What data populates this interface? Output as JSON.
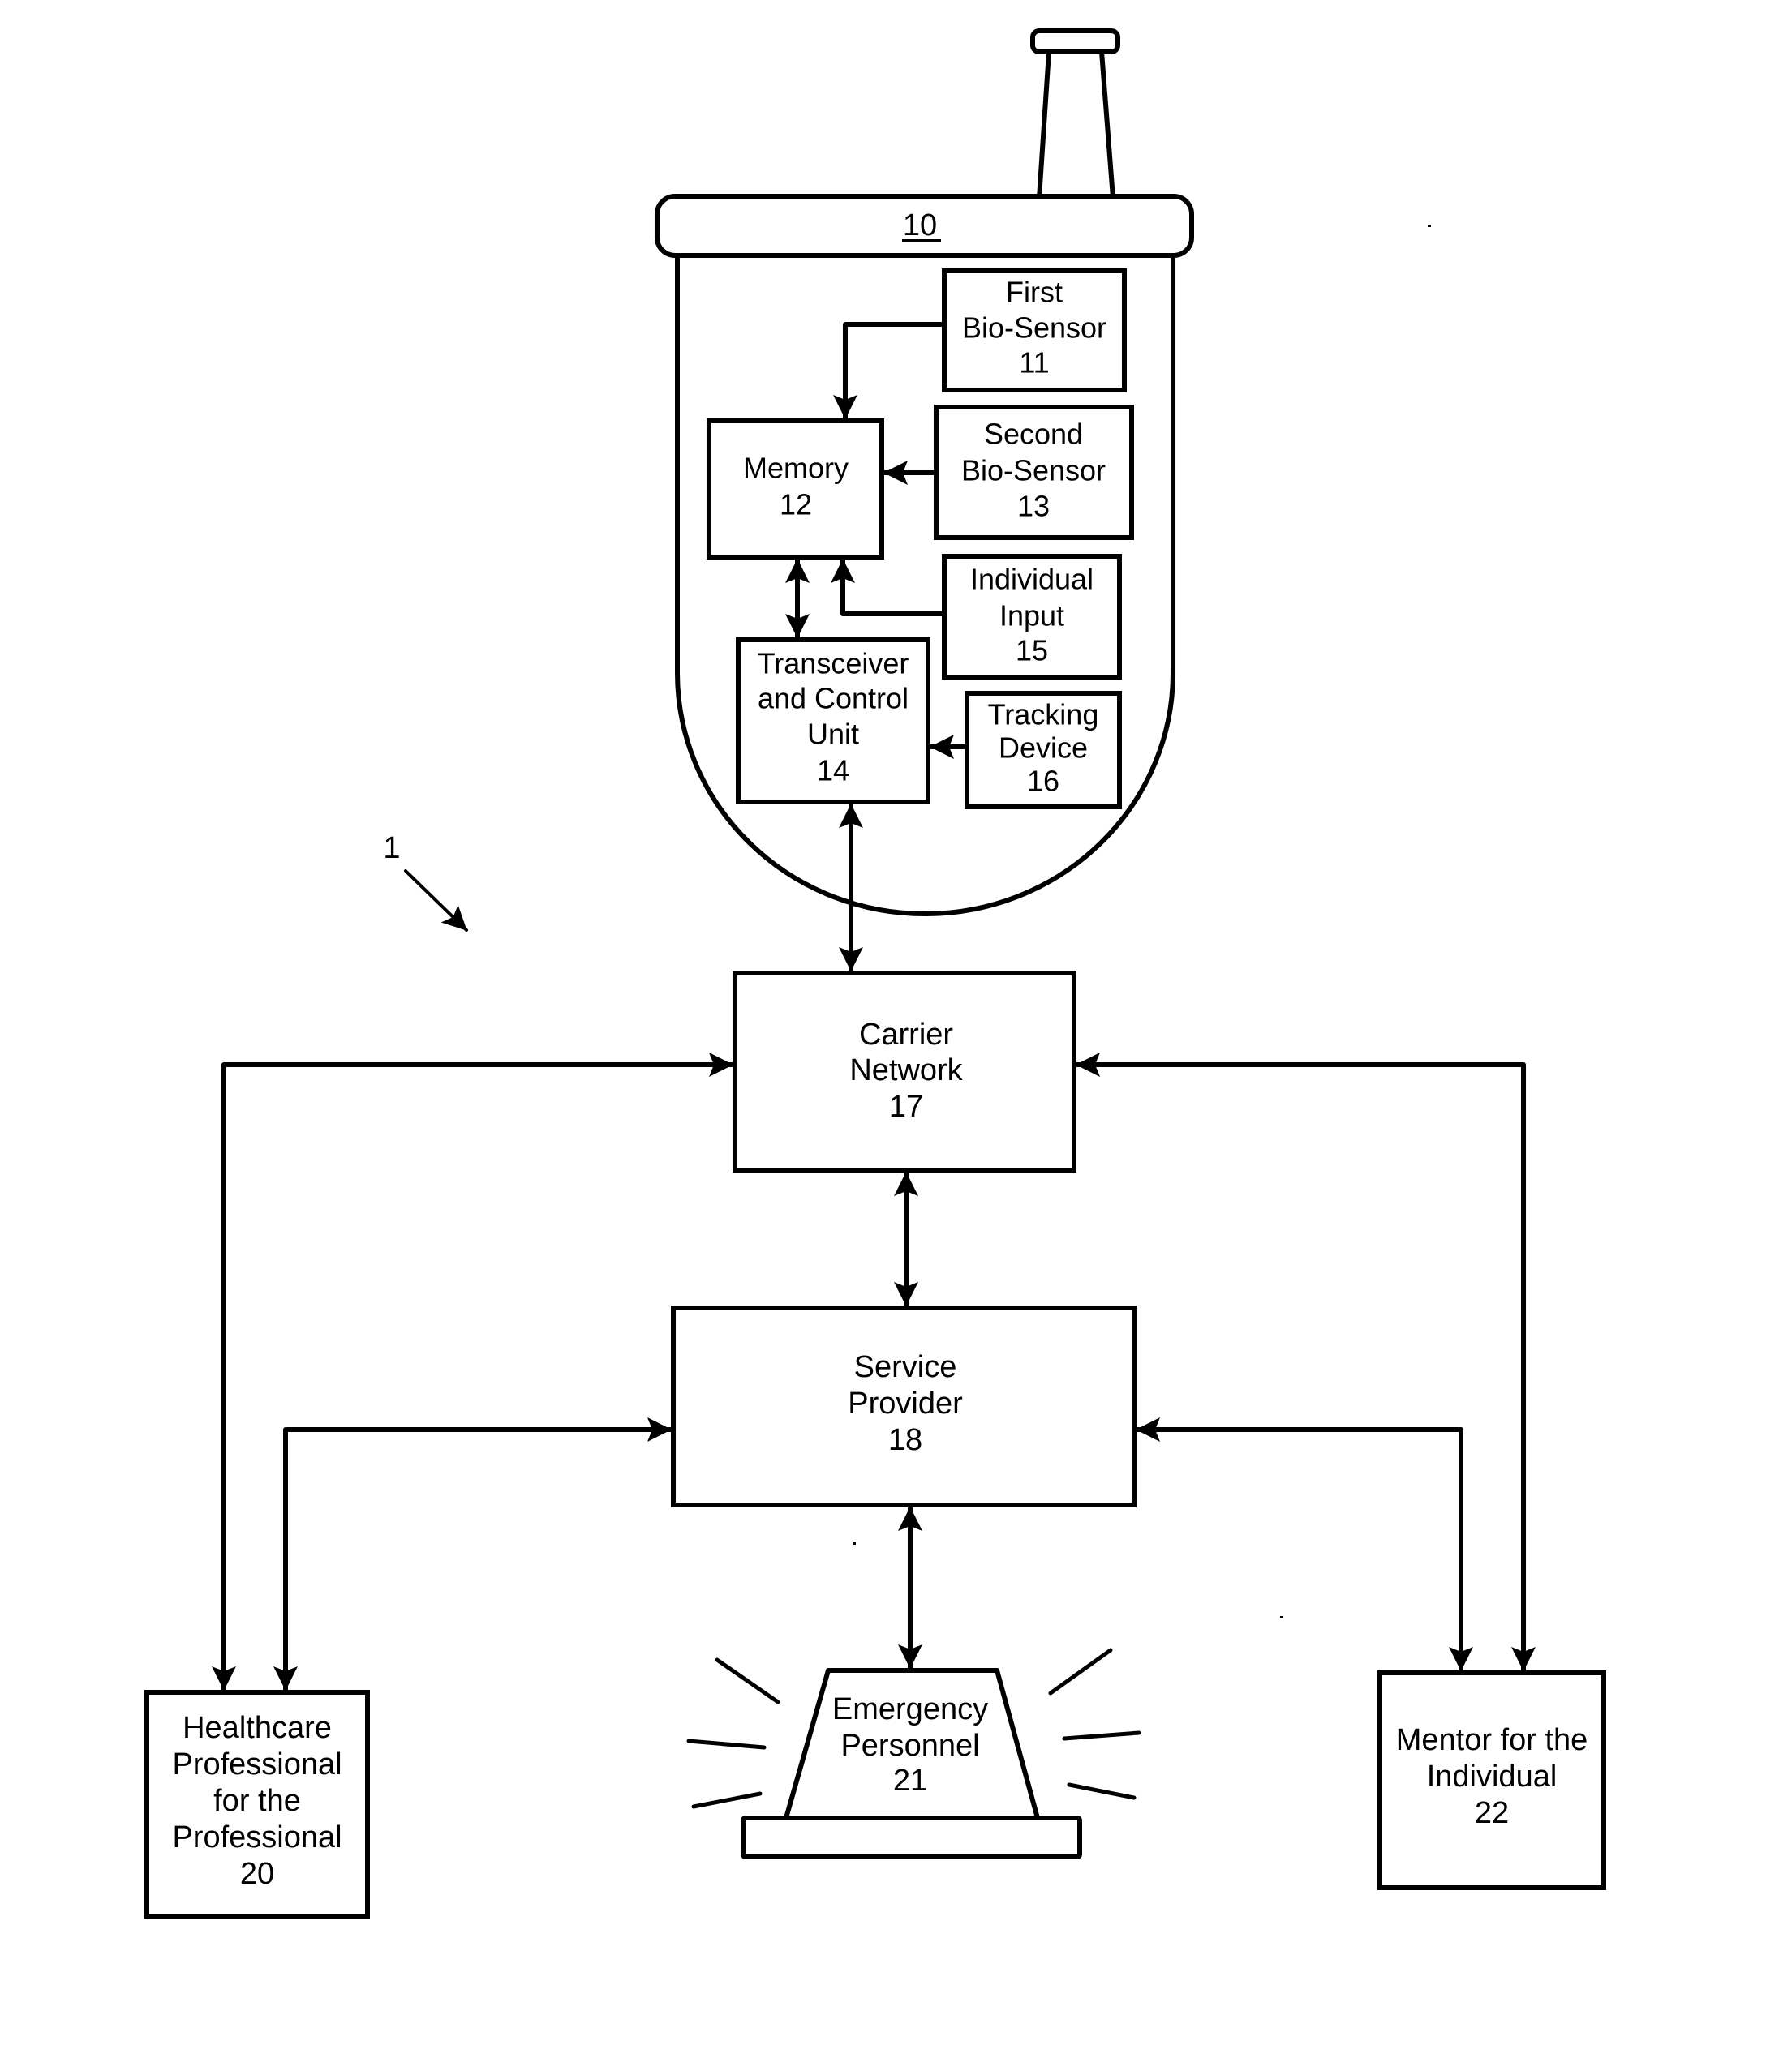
{
  "figure": {
    "system_ref": "1",
    "device": {
      "ref": "10",
      "components": {
        "first_bio_sensor": {
          "lines": [
            "First",
            "Bio-Sensor",
            "11"
          ]
        },
        "memory": {
          "lines": [
            "Memory",
            "12"
          ]
        },
        "second_bio_sensor": {
          "lines": [
            "Second",
            "Bio-Sensor",
            "13"
          ]
        },
        "transceiver": {
          "lines": [
            "Transceiver",
            "and Control",
            "Unit",
            "14"
          ]
        },
        "individual_input": {
          "lines": [
            "Individual",
            "Input",
            "15"
          ]
        },
        "tracking_device": {
          "lines": [
            "Tracking",
            "Device",
            "16"
          ]
        }
      }
    },
    "carrier_network": {
      "lines": [
        "Carrier",
        "Network",
        "17"
      ]
    },
    "service_provider": {
      "lines": [
        "Service",
        "Provider",
        "18"
      ]
    },
    "healthcare_professional": {
      "lines": [
        "Healthcare",
        "Professional",
        "for the",
        "Professional",
        "20"
      ]
    },
    "emergency_personnel": {
      "lines": [
        "Emergency",
        "Personnel",
        "21"
      ]
    },
    "mentor": {
      "lines": [
        "Mentor for the",
        "Individual",
        "22"
      ]
    },
    "connections": [
      {
        "from": "First Bio-Sensor 11",
        "to": "Memory 12",
        "direction": "one-way"
      },
      {
        "from": "Second Bio-Sensor 13",
        "to": "Memory 12",
        "direction": "one-way"
      },
      {
        "from": "Individual Input 15",
        "to": "Memory 12",
        "direction": "one-way"
      },
      {
        "from": "Memory 12",
        "to": "Transceiver and Control Unit 14",
        "direction": "two-way"
      },
      {
        "from": "Tracking Device 16",
        "to": "Transceiver and Control Unit 14",
        "direction": "one-way"
      },
      {
        "from": "Transceiver and Control Unit 14",
        "to": "Carrier Network 17",
        "direction": "two-way"
      },
      {
        "from": "Carrier Network 17",
        "to": "Service Provider 18",
        "direction": "two-way"
      },
      {
        "from": "Carrier Network 17",
        "to": "Healthcare Professional 20",
        "direction": "two-way"
      },
      {
        "from": "Carrier Network 17",
        "to": "Mentor 22",
        "direction": "two-way"
      },
      {
        "from": "Service Provider 18",
        "to": "Healthcare Professional 20",
        "direction": "two-way"
      },
      {
        "from": "Service Provider 18",
        "to": "Mentor 22",
        "direction": "two-way"
      },
      {
        "from": "Service Provider 18",
        "to": "Emergency Personnel 21",
        "direction": "two-way"
      }
    ]
  }
}
